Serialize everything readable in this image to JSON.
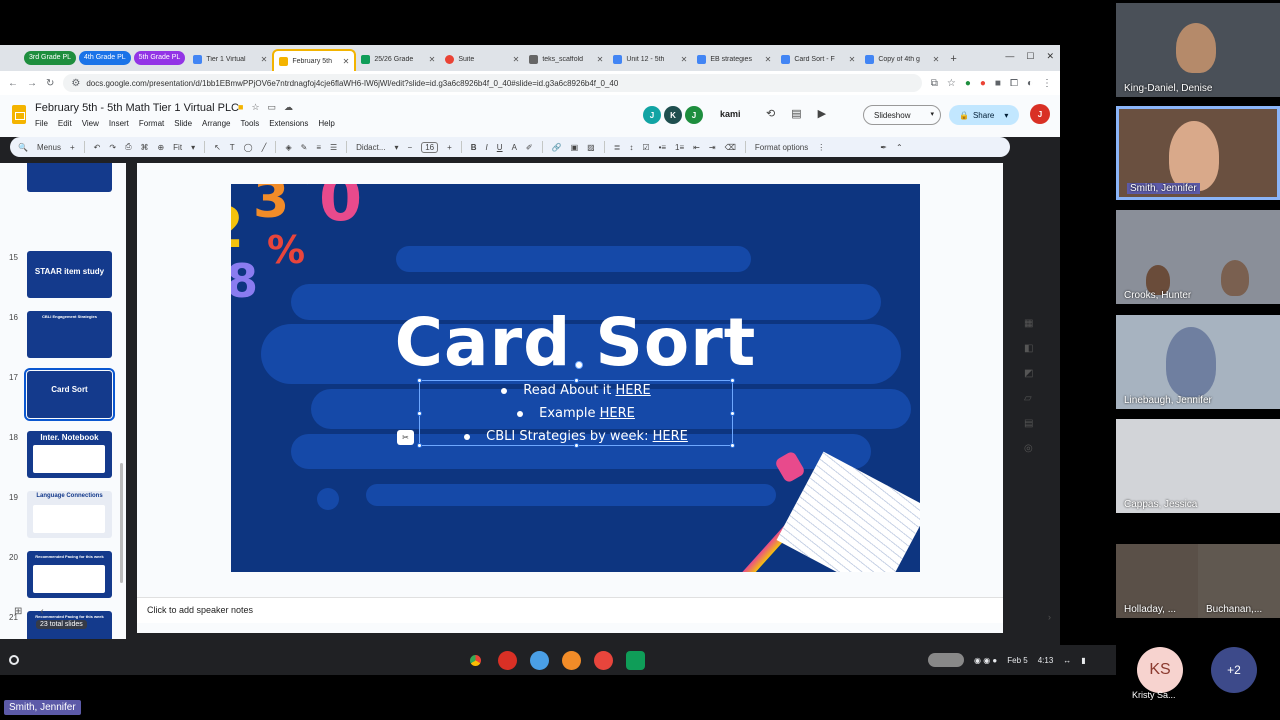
{
  "browser": {
    "tab_groups": [
      {
        "label": "3rd Grade PL",
        "color": "#1e8e3e"
      },
      {
        "label": "4th Grade PL",
        "color": "#1a73e8"
      },
      {
        "label": "5th Grade PL",
        "color": "#9334e6"
      }
    ],
    "tabs": [
      {
        "label": "Tier 1 Virtual",
        "fav": "#4285f4",
        "active": false
      },
      {
        "label": "February 5th",
        "fav": "#f4b400",
        "active": true
      },
      {
        "label": "25/26 Grade",
        "fav": "#0f9d58",
        "active": false
      },
      {
        "label": "Suite",
        "fav": "#ea4335",
        "active": false
      },
      {
        "label": "teks_scaffold",
        "fav": "#666666",
        "active": false
      },
      {
        "label": "Unit 12 - 5th",
        "fav": "#4285f4",
        "active": false
      },
      {
        "label": "EB strategies",
        "fav": "#4285f4",
        "active": false
      },
      {
        "label": "Card Sort - F",
        "fav": "#4285f4",
        "active": false
      },
      {
        "label": "Copy of 4th g",
        "fav": "#4285f4",
        "active": false
      }
    ],
    "url": "docs.google.com/presentation/d/1bb1EBmwPPjOV6e7ntrdnagfoj4cje6flaWH6-IW6jWl/edit?slide=id.g3a6c8926b4f_0_40#slide=id.g3a6c8926b4f_0_40"
  },
  "docs": {
    "title": "February 5th - 5th Math Tier 1 Virtual PLC",
    "menu": [
      "File",
      "Edit",
      "View",
      "Insert",
      "Format",
      "Slide",
      "Arrange",
      "Tools",
      "Extensions",
      "Help"
    ],
    "avatars": [
      {
        "letter": "J",
        "color": "#12a4a4"
      },
      {
        "letter": "K",
        "color": "#1f4f4f"
      },
      {
        "letter": "J",
        "color": "#1e8e3e"
      }
    ],
    "kami_label": "kami",
    "slideshow_label": "Slideshow",
    "share_label": "Share",
    "user_letter": "J",
    "toolbar": {
      "menus": "Menus",
      "zoom": "Fit",
      "font": "Didact...",
      "font_size": "16",
      "format_options": "Format options"
    }
  },
  "filmstrip": {
    "slides": [
      {
        "num": "",
        "title": ""
      },
      {
        "num": "15",
        "title": "STAAR item study"
      },
      {
        "num": "16",
        "title": "CBLI Engagement Strategies"
      },
      {
        "num": "17",
        "title": "Card Sort"
      },
      {
        "num": "18",
        "title": "Inter. Notebook"
      },
      {
        "num": "19",
        "title": "Language Connections"
      },
      {
        "num": "20",
        "title": "Recommended Pacing for this week"
      },
      {
        "num": "21",
        "title": "Recommended Pacing for this week"
      }
    ],
    "total_label": "23 total slides"
  },
  "slide": {
    "title": "Card Sort",
    "bullets": [
      {
        "text": "Read About it ",
        "link": "HERE"
      },
      {
        "text": "Example ",
        "link": "HERE"
      },
      {
        "text": "CBLI Strategies by week: ",
        "link": "HERE"
      }
    ],
    "decor_numbers": [
      "3",
      "0",
      "2",
      "%",
      "8"
    ]
  },
  "notes_placeholder": "Click to add speaker notes",
  "taskbar": {
    "date": "Feb 5",
    "time": "4:13"
  },
  "participants": [
    {
      "name": "King-Daniel, Denise",
      "speaking": false
    },
    {
      "name": "Smith, Jennifer",
      "speaking": true
    },
    {
      "name": "Crooks, Hunter",
      "speaking": false
    },
    {
      "name": "Linebaugh, Jennifer",
      "speaking": false
    },
    {
      "name": "Cappas, Jessica",
      "speaking": false
    },
    {
      "name": "Holladay, ...",
      "speaking": false
    },
    {
      "name": "Buchanan,...",
      "speaking": false
    }
  ],
  "extra_participant": {
    "initials": "KS",
    "name": "Kristy Sa..."
  },
  "more_count": "+2",
  "presenter_badge": "Smith, Jennifer"
}
